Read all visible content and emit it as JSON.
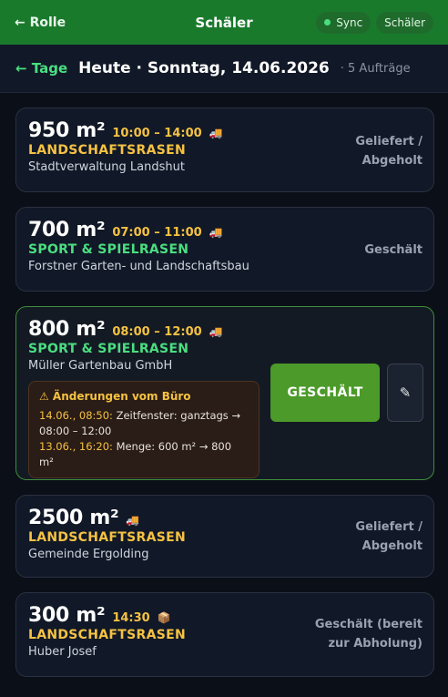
{
  "header": {
    "back_label": "← Rolle",
    "title": "Schäler",
    "sync_label": "Sync",
    "role_label": "Schäler"
  },
  "daybar": {
    "days_label": "← Tage",
    "date_label": "Heute · Sonntag, 14.06.2026",
    "count_label": "· 5 Aufträge"
  },
  "orders": [
    {
      "qty": "950 m²",
      "time": "10:00 – 14:00",
      "icon": "truck-icon",
      "product": "LANDSCHAFTSRASEN",
      "product_color": "#f5c242",
      "customer": "Stadtverwaltung Landshut",
      "status_line1": "Geliefert /",
      "status_line2": "Abgeholt"
    },
    {
      "qty": "700 m²",
      "time": "07:00 – 11:00",
      "icon": "truck-icon",
      "product": "SPORT & SPIELRASEN",
      "product_color": "#4ade80",
      "customer": "Forstner Garten- und Landschaftsbau",
      "status_line1": "Geschält"
    },
    {
      "qty": "800 m²",
      "time": "08:00 – 12:00",
      "icon": "truck-icon",
      "product": "SPORT & SPIELRASEN",
      "product_color": "#4ade80",
      "customer": "Müller Gartenbau GmbH",
      "changes": {
        "title": "⚠ Änderungen vom Büro",
        "items": [
          {
            "ts": "14.06., 08:50:",
            "text": "Zeitfenster: ganztags → 08:00 – 12:00"
          },
          {
            "ts": "13.06., 16:20:",
            "text": "Menge: 600 m² → 800 m²"
          }
        ]
      },
      "action_label": "GESCHÄLT",
      "edit_icon": "pencil-icon"
    },
    {
      "qty": "2500 m²",
      "icon": "truck-icon",
      "product": "LANDSCHAFTSRASEN",
      "product_color": "#f5c242",
      "customer": "Gemeinde Ergolding",
      "status_line1": "Geliefert /",
      "status_line2": "Abgeholt"
    },
    {
      "qty": "300 m²",
      "time": "14:30",
      "icon": "package-icon",
      "product": "LANDSCHAFTSRASEN",
      "product_color": "#f5c242",
      "customer": "Huber Josef",
      "status_line1": "Geschält (bereit",
      "status_line2": "zur Abholung)"
    }
  ],
  "colors": {
    "header_bg": "#1a7a2c",
    "accent_green": "#4ade80",
    "accent_yellow": "#f5c242",
    "primary_button": "#4c9a2a",
    "background": "#0b0f17"
  }
}
